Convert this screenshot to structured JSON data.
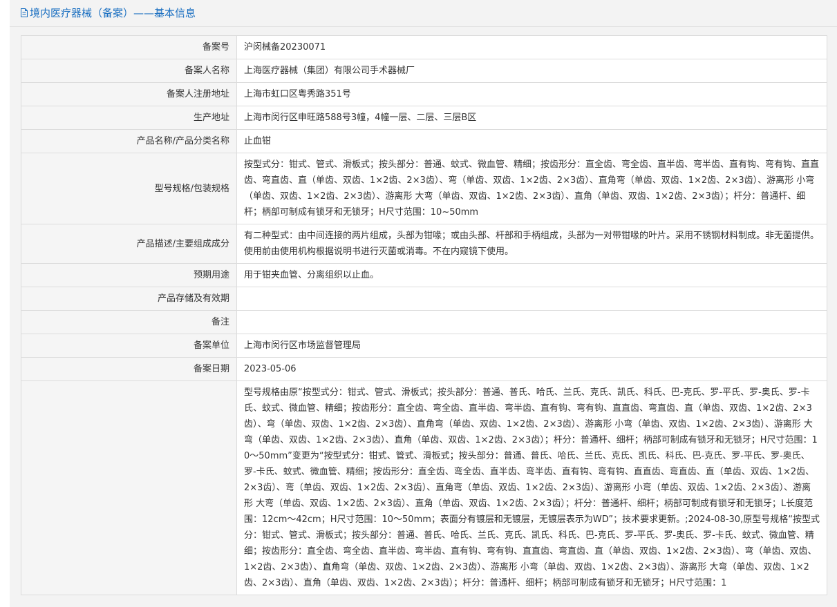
{
  "header": {
    "title": "境内医疗器械（备案）——基本信息",
    "icon": "document-icon"
  },
  "rows": [
    {
      "label": "备案号",
      "value": "沪闵械备20230071"
    },
    {
      "label": "备案人名称",
      "value": "上海医疗器械（集团）有限公司手术器械厂"
    },
    {
      "label": "备案人注册地址",
      "value": "上海市虹口区粤秀路351号"
    },
    {
      "label": "生产地址",
      "value": "上海市闵行区申旺路588号3幢，4幢一层、二层、三层B区"
    },
    {
      "label": "产品名称/产品分类名称",
      "value": "止血钳"
    },
    {
      "label": "型号规格/包装规格",
      "value": "按型式分：钳式、管式、滑板式；按头部分：普通、蚊式、微血管、精细；按齿形分：直全齿、弯全齿、直半齿、弯半齿、直有钩、弯有钩、直直齿、弯直齿、直（单齿、双齿、1×2齿、2×3齿）、弯（单齿、双齿、1×2齿、2×3齿）、直角弯（单齿、双齿、1×2齿、2×3齿）、游离形 小弯（单齿、双齿、1×2齿、2×3齿）、游离形 大弯（单齿、双齿、1×2齿、2×3齿）、直角（单齿、双齿、1×2齿、2×3齿）；杆分：普通杆、细杆；柄部可制成有锁牙和无锁牙；H尺寸范围：10~50mm"
    },
    {
      "label": "产品描述/主要组成成分",
      "value": "有二种型式：由中间连接的两片组成，头部为钳喙；或由头部、杆部和手柄组成，头部为一对带钳喙的叶片。采用不锈钢材料制成。非无菌提供。使用前由使用机构根据说明书进行灭菌或消毒。不在内窥镜下使用。"
    },
    {
      "label": "预期用途",
      "value": "用于钳夹血管、分离组织以止血。"
    },
    {
      "label": "产品存储及有效期",
      "value": ""
    },
    {
      "label": "备注",
      "value": ""
    },
    {
      "label": "备案单位",
      "value": "上海市闵行区市场监督管理局"
    },
    {
      "label": "备案日期",
      "value": "2023-05-06"
    },
    {
      "label": "",
      "value": "型号规格由原“按型式分：钳式、管式、滑板式；按头部分：普通、普氏、哈氏、兰氏、克氏、凯氏、科氏、巴-克氏、罗-平氏、罗-奥氏、罗-卡氏、蚊式、微血管、精细；按齿形分：直全齿、弯全齿、直半齿、弯半齿、直有钩、弯有钩、直直齿、弯直齿、直（单齿、双齿、1×2齿、2×3齿）、弯（单齿、双齿、1×2齿、2×3齿）、直角弯（单齿、双齿、1×2齿、2×3齿）、游离形 小弯（单齿、双齿、1×2齿、2×3齿）、游离形 大弯（单齿、双齿、1×2齿、2×3齿）、直角（单齿、双齿、1×2齿、2×3齿）；杆分：普通杆、细杆；柄部可制成有锁牙和无锁牙；H尺寸范围：10～50mm”变更为“按型式分：钳式、管式、滑板式；按头部分：普通、普氏、哈氏、兰氏、克氏、凯氏、科氏、巴-克氏、罗-平氏、罗-奥氏、罗-卡氏、蚊式、微血管、精细；按齿形分：直全齿、弯全齿、直半齿、弯半齿、直有钩、弯有钩、直直齿、弯直齿、直（单齿、双齿、1×2齿、2×3齿）、弯（单齿、双齿、1×2齿、2×3齿）、直角弯（单齿、双齿、1×2齿、2×3齿）、游离形 小弯（单齿、双齿、1×2齿、2×3齿）、游离形 大弯（单齿、双齿、1×2齿、2×3齿）、直角（单齿、双齿、1×2齿、2×3齿）；杆分：普通杆、细杆；柄部可制成有锁牙和无锁牙；L长度范围：12cm～42cm；H尺寸范围：10～50mm；表面分有镀层和无镀层，无镀层表示为WD”；技术要求更新。;2024-08-30,原型号规格“按型式分：钳式、管式、滑板式；按头部分：普通、普氏、哈氏、兰氏、克氏、凯氏、科氏、巴-克氏、罗-平氏、罗-奥氏、罗-卡氏、蚊式、微血管、精细；按齿形分：直全齿、弯全齿、直半齿、弯半齿、直有钩、弯有钩、直直齿、弯直齿、直（单齿、双齿、1×2齿、2×3齿）、弯（单齿、双齿、1×2齿、2×3齿）、直角弯（单齿、双齿、1×2齿、2×3齿）、游离形 小弯（单齿、双齿、1×2齿、2×3齿）、游离形 大弯（单齿、双齿、1×2齿、2×3齿）、直角（单齿、双齿、1×2齿、2×3齿）；杆分：普通杆、细杆；柄部可制成有锁牙和无锁牙；H尺寸范围：1"
    }
  ]
}
